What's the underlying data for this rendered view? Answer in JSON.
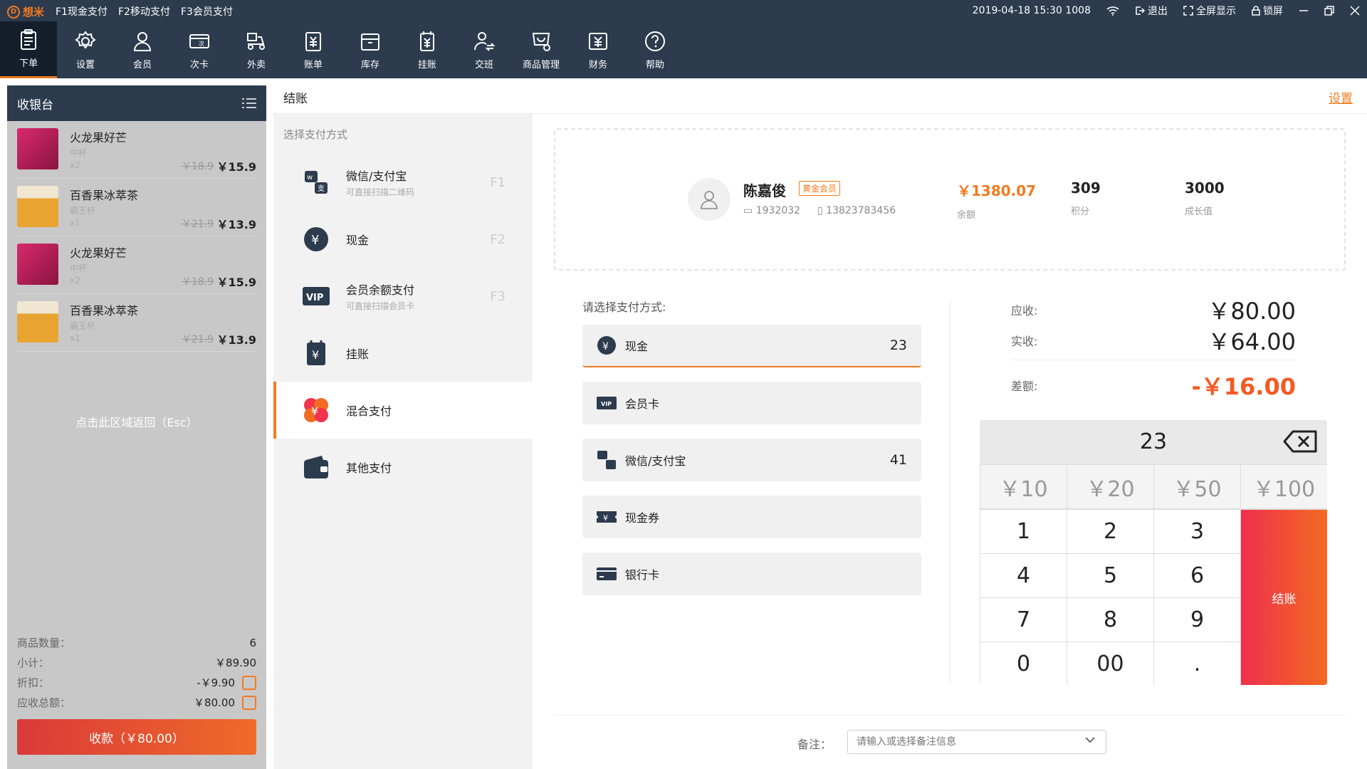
{
  "titlebar": {
    "brand": "想米",
    "hotkeys": [
      "F1现金支付",
      "F2移动支付",
      "F3会员支付"
    ],
    "datetime": "2019-04-18 15:30 1008",
    "logout": "退出",
    "fullscreen": "全屏显示",
    "lock": "锁屏"
  },
  "toolbar": [
    {
      "label": "下单",
      "icon": "clipboard-icon",
      "active": true
    },
    {
      "label": "设置",
      "icon": "gear-icon"
    },
    {
      "label": "会员",
      "icon": "user-icon"
    },
    {
      "label": "次卡",
      "icon": "card-icon"
    },
    {
      "label": "外卖",
      "icon": "scooter-icon"
    },
    {
      "label": "账单",
      "icon": "bill-icon"
    },
    {
      "label": "库存",
      "icon": "box-icon"
    },
    {
      "label": "挂账",
      "icon": "ledger-icon"
    },
    {
      "label": "交班",
      "icon": "handover-icon"
    },
    {
      "label": "商品管理",
      "icon": "goods-icon"
    },
    {
      "label": "财务",
      "icon": "finance-icon"
    },
    {
      "label": "帮助",
      "icon": "help-icon"
    }
  ],
  "cashier": {
    "title": "收银台",
    "items": [
      {
        "name": "火龙果好芒",
        "spec": "中杯",
        "qty": "x2",
        "old_price": "￥18.9",
        "price": "￥15.9",
        "color": "#c81d5a"
      },
      {
        "name": "百香果冰萃茶",
        "spec": "霸王杯",
        "qty": "x1",
        "old_price": "￥21.9",
        "price": "￥13.9",
        "color": "#e8a431"
      },
      {
        "name": "火龙果好芒",
        "spec": "中杯",
        "qty": "x2",
        "old_price": "￥18.9",
        "price": "￥15.9",
        "color": "#c81d5a"
      },
      {
        "name": "百香果冰萃茶",
        "spec": "霸王杯",
        "qty": "x1",
        "old_price": "￥21.9",
        "price": "￥13.9",
        "color": "#e8a431"
      }
    ],
    "back_hint": "点击此区域返回（Esc）",
    "summary": {
      "count_label": "商品数量：",
      "count": "6",
      "subtotal_label": "小计：",
      "subtotal": "￥89.90",
      "discount_label": "折扣：",
      "discount": "-￥9.90",
      "total_label": "应收总额：",
      "total": "￥80.00"
    },
    "collect_button": "收款（￥80.00）"
  },
  "checkout": {
    "title": "结账",
    "settings_link": "设置",
    "choose_label": "选择支付方式",
    "methods": [
      {
        "name": "微信/支付宝",
        "desc": "可直接扫描二维码",
        "key": "F1"
      },
      {
        "name": "现金",
        "desc": "",
        "key": "F2"
      },
      {
        "name": "会员余额支付",
        "desc": "可直接扫描会员卡",
        "key": "F3"
      },
      {
        "name": "挂账",
        "desc": "",
        "key": ""
      },
      {
        "name": "混合支付",
        "desc": "",
        "key": ""
      },
      {
        "name": "其他支付",
        "desc": "",
        "key": ""
      }
    ]
  },
  "member": {
    "name": "陈嘉俊",
    "level": "黄金会员",
    "card_no": "1932032",
    "phone": "13823783456",
    "balance": "￥1380.07",
    "balance_label": "余额",
    "points": "309",
    "points_label": "积分",
    "growth": "3000",
    "growth_label": "成长值"
  },
  "mixed": {
    "label": "请选择支付方式:",
    "options": [
      {
        "name": "现金",
        "value": "23"
      },
      {
        "name": "会员卡",
        "value": ""
      },
      {
        "name": "微信/支付宝",
        "value": "41"
      },
      {
        "name": "现金券",
        "value": ""
      },
      {
        "name": "银行卡",
        "value": ""
      }
    ]
  },
  "amounts": {
    "due_label": "应收:",
    "due": "￥80.00",
    "paid_label": "实收:",
    "paid": "￥64.00",
    "diff_label": "差额:",
    "diff": "-￥16.00"
  },
  "keypad": {
    "display": "23",
    "quick": [
      "￥10",
      "￥20",
      "￥50",
      "￥100"
    ],
    "keys": [
      "1",
      "2",
      "3",
      "4",
      "5",
      "6",
      "7",
      "8",
      "9",
      "0",
      "00",
      "."
    ],
    "checkout": "结账"
  },
  "note": {
    "label": "备注：",
    "placeholder": "请输入或选择备注信息"
  }
}
